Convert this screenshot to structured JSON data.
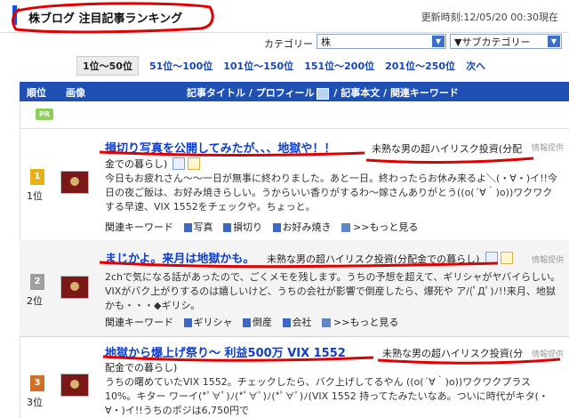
{
  "header": {
    "title": "株ブログ 注目記事ランキング",
    "update_label": "更新時刻:12/05/20 00:30現在"
  },
  "filters": {
    "category_label": "カテゴリー",
    "category_value": "株",
    "subcategory_value": "▼サブカテゴリー"
  },
  "pager": {
    "pages": [
      "1位〜50位",
      "51位〜100位",
      "101位〜150位",
      "151位〜200位",
      "201位〜250位",
      "次へ"
    ]
  },
  "table_header": {
    "rank": "順位",
    "image": "画像",
    "title_link": "記事タイトル",
    "profile": "プロフィール",
    "body": "記事本文",
    "keywords": "関連キーワード",
    "separator": "/"
  },
  "pr_label": "PR",
  "rows": [
    {
      "rank": "1位",
      "badge": "1",
      "title": "損切り写真を公開してみたが、、、地獄や！！",
      "source": "未熟な男の超ハイリスク投資(分配",
      "source_cont": "金での暮らし)",
      "info": "情報提供",
      "excerpt": "今日もお疲れさん〜〜一日が無事に終わりました。あと一日。終わったらお休み来るよ＼(・∀・)イ!!今日の夜ご飯は、お好み焼きらしい。うからいい香りがするわ〜嫁さんありがとう((o(´∀｀)o))ワクワクする早速、VIX 1552をチェックや。ちょっと。",
      "keywords_label": "関連キーワード",
      "keywords": [
        "写真",
        "損切り",
        "お好み焼き"
      ],
      "more": "もっと見る"
    },
    {
      "rank": "2位",
      "badge": "2",
      "title": "まじかよ。来月は地獄かも。",
      "source": "未熟な男の超ハイリスク投資(分配金での暮らし)",
      "info": "情報提供",
      "excerpt": "2chで気になる話があったので、ごくメモを残します。うちの予想を超えて、ギリシャがヤバイらしい。VIXがバク上がりするのは嬉しいけど、うちの会社が影響で倒産したら、爆死や ア/(ﾟДﾟ)ﾉ!!来月、地獄かも・・・◆ギリシ。",
      "keywords_label": "関連キーワード",
      "keywords": [
        "ギリシャ",
        "倒産",
        "会社"
      ],
      "more": "もっと見る"
    },
    {
      "rank": "3位",
      "badge": "3",
      "title": "地獄から爆上げ祭り〜 利益500万 VIX 1552",
      "source": "未熟な男の超ハイリスク投資(分",
      "source_cont": "配金での暮らし)",
      "info": "情報提供",
      "excerpt": "うちの曙めていたVIX 1552。チェックしたら、バク上げしてるやん ((o(´∀｀)o))ワクワクプラス10%。キター ワーイ(*ﾟ∀ﾟ)ﾉ(*ﾟ∀ﾟ)ﾉ(*ﾟ∀ﾟ)ﾉ(VIX 1552 持ってたみたいなあ。ついに時代がキタ(・∀・)イ!!うちのポジは6,750円で"
    }
  ],
  "colors": {
    "header_blue": "#1f51b5",
    "link_blue": "#0f3ec7",
    "annotation_red": "#e00000"
  }
}
